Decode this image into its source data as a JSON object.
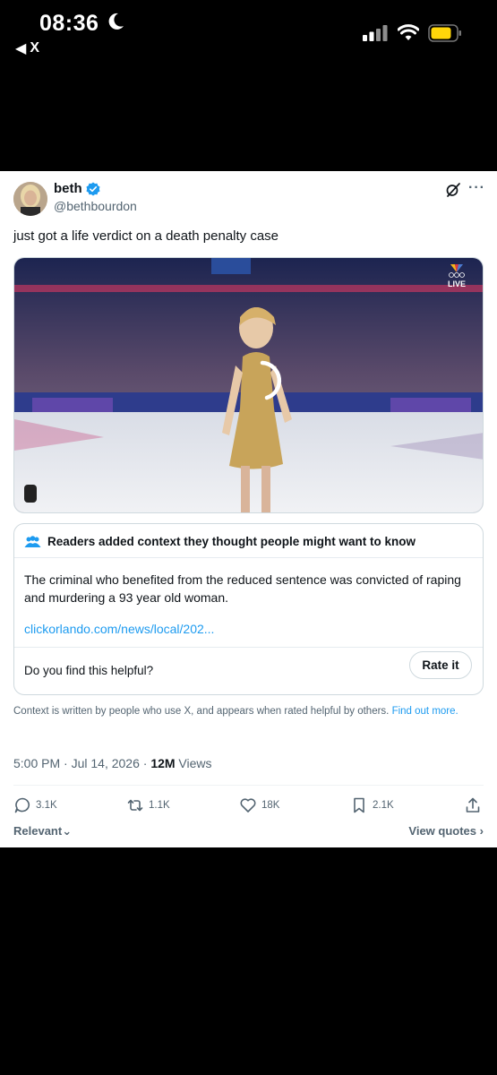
{
  "status_bar": {
    "time": "08:36",
    "back_label": "X",
    "battery_color": "#ffd60a"
  },
  "tweet": {
    "author_name": "beth",
    "handle": "@bethbourdon",
    "verified": true,
    "text": "just got a life verdict on a death penalty case",
    "media": {
      "badge": "LIVE",
      "type": "video"
    },
    "community_note": {
      "header": "Readers added context they thought people might want to know",
      "body": "The criminal who benefited from the reduced sentence was convicted of raping and murdering a 93 year old woman.",
      "link": "clickorlando.com/news/local/202...",
      "helpful_prompt": "Do you find this helpful?",
      "rate_label": "Rate it"
    },
    "disclaimer": "Context is written by people who use X, and appears when rated helpful by others.",
    "find_out_more": "Find out more.",
    "timestamp": "5:00 PM · Jul 14, 2026 · ",
    "views_count": "12M",
    "views_label": " Views",
    "stats": {
      "replies": "3.1K",
      "reposts": "1.1K",
      "likes": "18K",
      "bookmarks": "2.1K"
    },
    "sort_label": "Relevant",
    "view_quotes": "View quotes"
  },
  "colors": {
    "accent": "#1d9bf0",
    "secondary_text": "#536471"
  },
  "icons": [
    "moon-icon",
    "signal-icon",
    "wifi-icon",
    "battery-icon",
    "verified-icon",
    "grok-icon",
    "more-icon",
    "reply-icon",
    "repost-icon",
    "like-icon",
    "bookmark-icon",
    "share-icon",
    "chevron-down-icon",
    "chevron-right-icon",
    "people-icon"
  ]
}
